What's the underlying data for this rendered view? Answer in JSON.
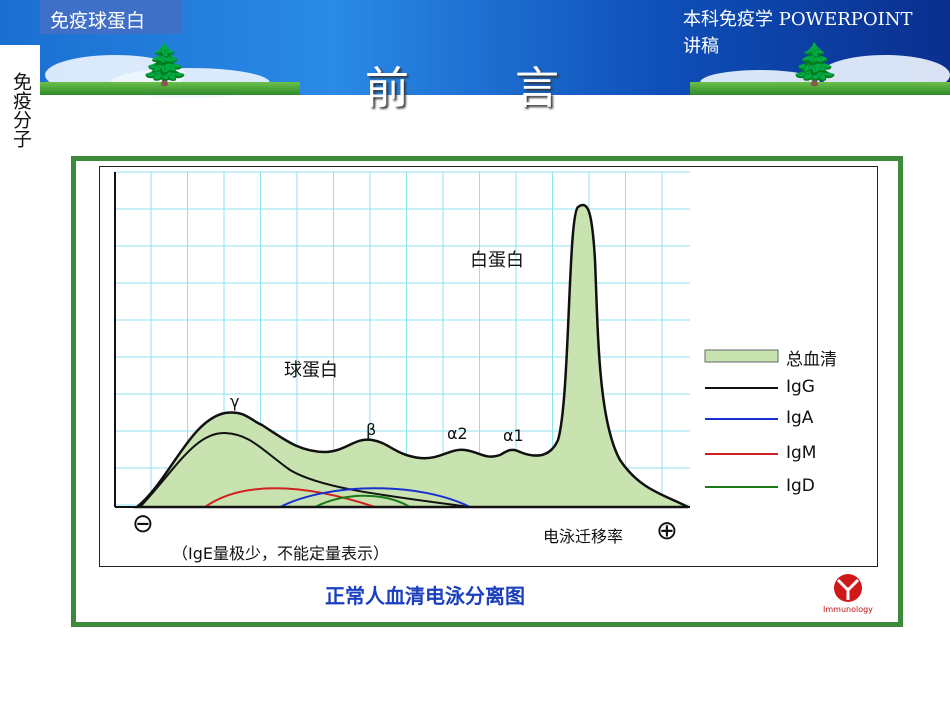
{
  "header": {
    "tab_label": "免疫球蛋白",
    "course_title": "本科免疫学 POWERPOINT 讲稿",
    "side_label": "免疫分子",
    "slide_title_1": "前",
    "slide_title_2": "言"
  },
  "diagram": {
    "peak_labels": {
      "albumin": "白蛋白",
      "globulin": "球蛋白",
      "gamma": "γ",
      "beta": "β",
      "alpha2": "α2",
      "alpha1": "α1"
    },
    "axis": {
      "minus": "⊖",
      "plus": "⊕",
      "label": "电泳迁移率"
    },
    "note": "（IgE量极少，不能定量表示）",
    "legend": [
      {
        "label": "总血清",
        "color": "#c8e3b0"
      },
      {
        "label": "IgG",
        "color": "#111111"
      },
      {
        "label": "IgA",
        "color": "#1a2fd0"
      },
      {
        "label": "IgM",
        "color": "#d02020"
      },
      {
        "label": "IgD",
        "color": "#1a7a1a"
      }
    ],
    "caption": "正常人血清电泳分离图",
    "logo_text": "Immunology"
  }
}
